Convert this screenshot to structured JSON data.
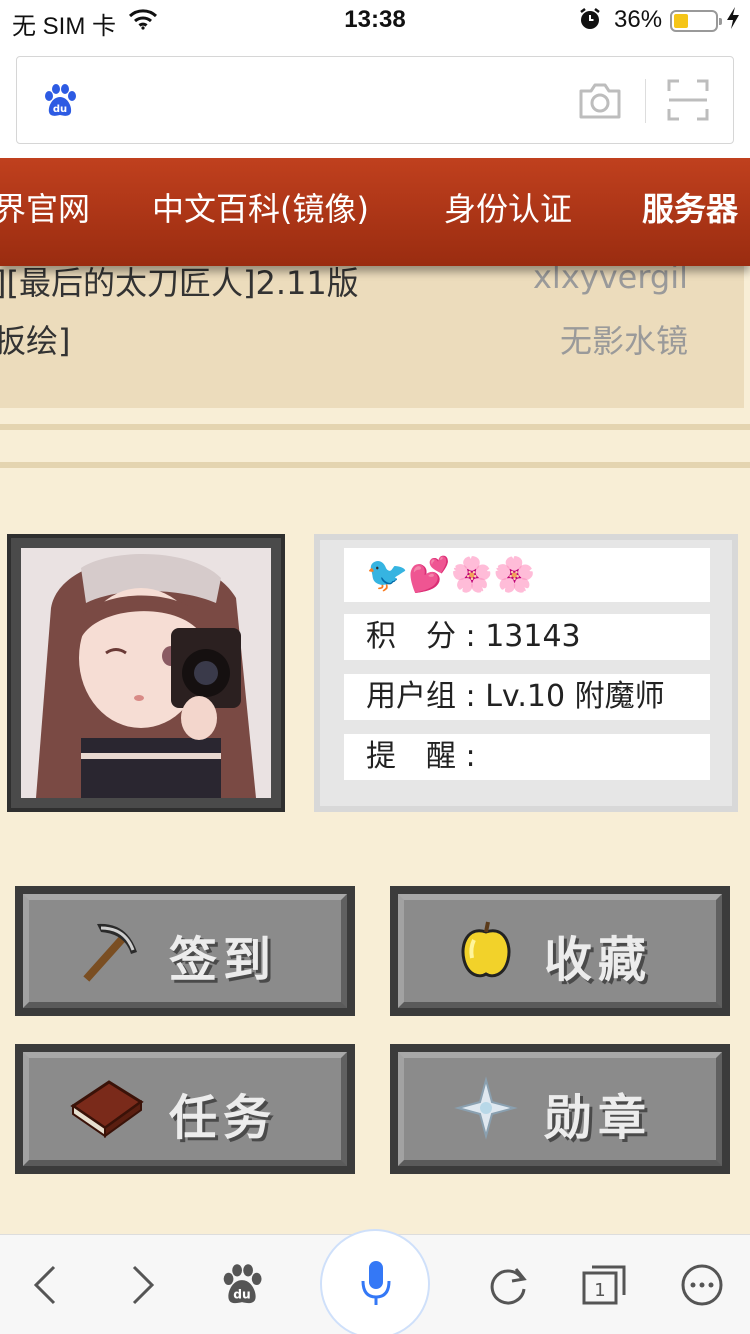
{
  "status_bar": {
    "carrier": "无 SIM 卡",
    "time": "13:38",
    "battery": "36%",
    "battery_level": 0.36,
    "icons": [
      "wifi-icon",
      "alarm-icon",
      "battery-icon",
      "charging-bolt-icon"
    ]
  },
  "search": {
    "logo_icon": "baidu-paw-icon",
    "camera_icon": "camera-icon",
    "scan_icon": "scan-icon"
  },
  "nav": {
    "items": [
      "界官网",
      "中文百科(镜像)",
      "身份认证",
      "服务器"
    ],
    "background": "#b03a1a"
  },
  "posts": [
    {
      "title": "][最后的太刀匠人]2.11版",
      "author": "xlxyvergil"
    },
    {
      "title": "扳绘]",
      "author": "无影水镜"
    }
  ],
  "profile": {
    "emoji": "🐦💕🌸🌸",
    "points_label": "积　分 :",
    "points_value": "13143",
    "group_label": "用户组 :",
    "group_value": "Lv.10 附魔师",
    "reminder_label": "提　醒 :",
    "reminder_value": ""
  },
  "menu": [
    {
      "label": "签到",
      "icon": "pickaxe-icon"
    },
    {
      "label": "收藏",
      "icon": "golden-apple-icon"
    },
    {
      "label": "任务",
      "icon": "book-icon"
    },
    {
      "label": "勋章",
      "icon": "nether-star-icon"
    }
  ],
  "toolbar": {
    "icons": [
      "back-arrow-icon",
      "forward-arrow-icon",
      "baidu-paw-icon",
      "microphone-icon",
      "refresh-icon",
      "tabs-icon",
      "more-icon"
    ],
    "tab_count": "1"
  },
  "colors": {
    "page_bg": "#f8eed6",
    "nav_red": "#b03a1a",
    "accent_blue": "#3478f6",
    "button_gray": "#8b8b8b"
  }
}
